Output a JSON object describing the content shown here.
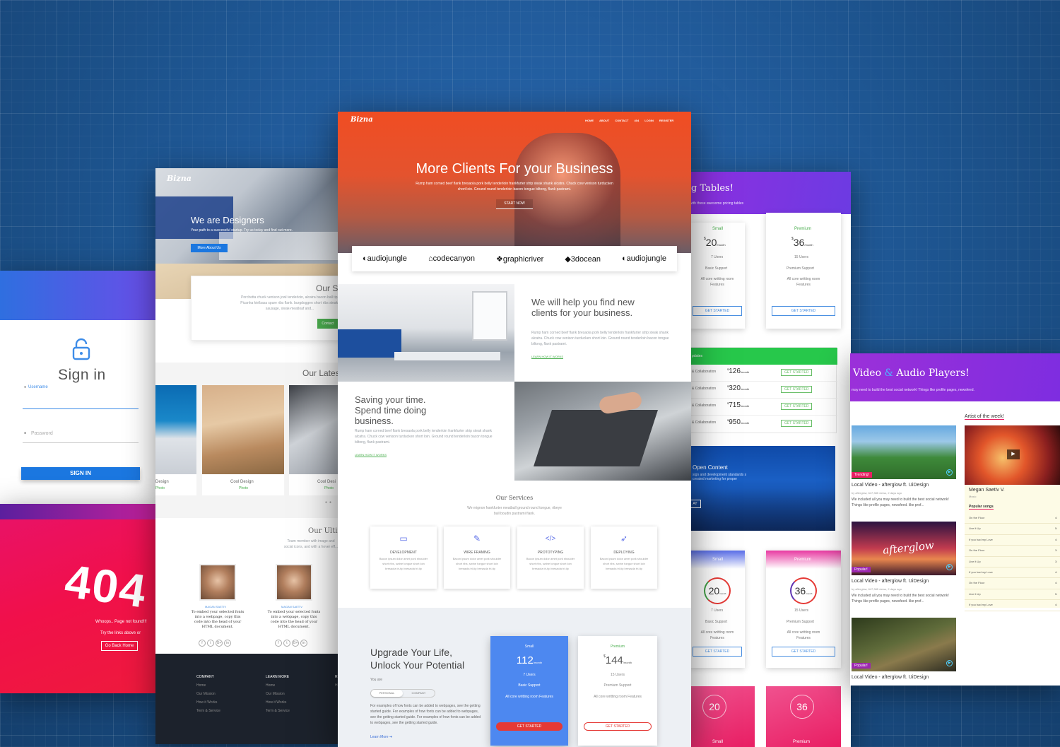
{
  "colors": {
    "bg": "#1f5ea8",
    "orange": "#f04d23",
    "purple": "#9b30d9",
    "red": "#f1104a",
    "blue": "#1b77e0"
  },
  "login": {
    "title": "Sign in",
    "username": "Username",
    "password": "Password",
    "button": "SIGN IN"
  },
  "e404": {
    "code": "404",
    "message": "Whoops.. Page not found!!!",
    "hint": "Try the links above or",
    "button": "Go Back Home"
  },
  "left": {
    "logo": "Bizna",
    "hero_title": "We are Designers",
    "hero_sub": "Your path to a successful startup. Try us today and find out more.",
    "hero_btn": "More About Us",
    "box_title": "Our St",
    "box_text": "Porchetta chuck venison jowl tenderloin, alcatra bacon ball tip. Picanha kielbasa spare ribs flank. burgdoggen short ribs steak-sausage, steak-meatloaf and...",
    "box_btn": "Contact",
    "latest_title": "Our Lates",
    "cards": [
      {
        "title": "Design",
        "cat": "Photo"
      },
      {
        "title": "Cool Design",
        "cat": "Photo"
      },
      {
        "title": "Cool Desi",
        "cat": "Photo"
      }
    ],
    "team_title": "Our Ultima",
    "team_sub": "Team member with image and social icons, and with a hover eff...",
    "members": [
      {
        "name": "MAGAN SAETIV",
        "text": "To embed your selected fonts into a webpage, copy this code into the head of your HTML document."
      },
      {
        "name": "MAGAN SAETIV",
        "text": "To embed your selected fonts into a webpage, copy this code into the head of your HTML document."
      }
    ],
    "social": [
      "f",
      "t",
      "G+",
      "in"
    ],
    "footer": [
      {
        "title": "COMPANY",
        "links": [
          "Home",
          "Our Mission",
          "How it Works",
          "Term & Service"
        ]
      },
      {
        "title": "LEARN MORE",
        "links": [
          "Home",
          "Our Mission",
          "How it Works",
          "Term & Service"
        ]
      },
      {
        "title": "R",
        "links": [
          "H"
        ]
      }
    ]
  },
  "main": {
    "logo": "Bizna",
    "nav": [
      "HOME",
      "ABOUT",
      "CONTACT",
      "404",
      "LOGIN",
      "REGISTER"
    ],
    "hero_title": "More Clients For your Business",
    "hero_text": "Rump ham corned beef flank bresaola pork belly tenderloin frankfurter strip steak shank alcatra. Chuck cow venison turducken short loin. Ground round tenderloin bacon tongue biltong, flank pastrami.",
    "hero_btn": "START NOW",
    "brands": [
      "audiojungle",
      "codecanyon",
      "graphicriver",
      "3docean",
      "audiojungle"
    ],
    "f1_title": "We will help you find new clients for your business.",
    "f1_text": "Rump ham corned beef flank bresaola pork belly tenderloin frankfurter strip steak shank alcatra. Chuck cow venison turducken short loin. Ground round tenderloin bacon tongue biltong, flank pastrami.",
    "f1_link": "LEARN HOW IT WORKS",
    "f2_title": "Saving your time. Spend time doing business.",
    "f2_text": "Rump ham corned beef flank bresaola pork belly tenderloin frankfurter strip steak shank alcatra. Chuck cow venison turducken short loin. Ground round tenderloin bacon tongue biltong, flank pastrami.",
    "f2_link": "LEARN HOW IT WORKS",
    "services_title": "Our Services",
    "services_sub": "We mignon frankfurter meatball ground round tongue, ribeye ball boudin pastrami flank.",
    "services": [
      {
        "icon": "laptop-icon",
        "glyph": "💻",
        "title": "DEVELOPMENT",
        "text": "Bacon ipsum dolor amet pork shoulder short ribs, swine tongue short loin bresaola tri-tip bresaola tri-tip"
      },
      {
        "icon": "pencil-icon",
        "glyph": "✎",
        "title": "WIRE FRAMING",
        "text": "Bacon ipsum dolor amet pork shoulder short ribs, swine tongue short loin bresaola tri-tip bresaola tri-tip"
      },
      {
        "icon": "code-icon",
        "glyph": "</>",
        "title": "PROTOTYPING",
        "text": "Bacon ipsum dolor amet pork shoulder short ribs, swine tongue short loin bresaola tri-tip bresaola tri-tip"
      },
      {
        "icon": "rocket-icon",
        "glyph": "🚀",
        "title": "DEPLOYING",
        "text": "Bacon ipsum dolor amet pork shoulder short ribs, swine tongue short loin bresaola tri-tip bresaola tri-tip"
      }
    ],
    "upgrade_title": "Upgrade Your Life, Unlock Your Potential",
    "you_are": "You are",
    "toggle": [
      "PERSONAL",
      "COMPANY"
    ],
    "upgrade_text": "For examples of how fonts can be added to webpages, see the getting started guide. For examples of how fonts can be added to webpages, see the getting started guide. For examples of how fonts can be added to webpages, see the getting started guide.",
    "learn_more": "Learn More ➔",
    "plans": [
      {
        "name": "Small",
        "price": "112",
        "per": "/month",
        "users": "7 Users",
        "support": "Basic Support",
        "features": "All core writting room Features",
        "btn": "GET STARTED"
      },
      {
        "name": "Premium",
        "price": "144",
        "per": "/month",
        "users": "15 Users",
        "support": "Premium Support",
        "features": "All core writting room Features",
        "btn": "GET STARTED"
      }
    ]
  },
  "right": {
    "title": "g Tables!",
    "sub": "with these awesome pricing tables",
    "plans": [
      {
        "name": "Small",
        "price": "20",
        "per": "/month",
        "users": "7 Users",
        "support": "Basic Support",
        "features": "All core writting room Features",
        "btn": "GET STARTED"
      },
      {
        "name": "Premium",
        "price": "36",
        "per": "/month",
        "users": "15 Users",
        "support": "Premium Support",
        "features": "All core writting room Features",
        "btn": "GET STARTED"
      }
    ],
    "list_header": "pdates",
    "rows": [
      {
        "label": "& Collaboration",
        "price": "126",
        "per": "/month",
        "btn": "GET STARTED"
      },
      {
        "label": "& Collaboration",
        "price": "320",
        "per": "/month",
        "btn": "GET STARTED"
      },
      {
        "label": "& Collaboration",
        "price": "715",
        "per": "/month",
        "btn": "GET STARTED"
      },
      {
        "label": "& Collaboration",
        "price": "950",
        "per": "/month",
        "btn": "GET STARTED"
      }
    ],
    "open_title": "Open Content",
    "open_text": "sign and development standards s created marketing for proper",
    "open_btn": "AY",
    "plans2": [
      {
        "name": "Small",
        "price": "20",
        "per": "/month",
        "users": "7 Users",
        "support": "Basic Support",
        "features": "All core writting room Features",
        "btn": "GET STARTED"
      },
      {
        "name": "Premium",
        "price": "36",
        "per": "/month",
        "users": "15 Users",
        "support": "Premium Support",
        "features": "All core writting room Features",
        "btn": "GET STARTED"
      }
    ],
    "plans3": [
      {
        "name": "Small",
        "price": "20"
      },
      {
        "name": "Premium",
        "price": "36"
      }
    ]
  },
  "video": {
    "title": "Video & Audio Players!",
    "title_a": "Video",
    "title_amp": "&",
    "title_b": "Audio Players!",
    "sub": "may need to build the best social network! Things like profile pages, newsfeed.",
    "items": [
      {
        "badge": "Trending!",
        "title": "Local Video - afterglow ft. UiDesign",
        "meta": "by afterglow, 647,385 views, 2 days ago",
        "text": "We included all you may need to build the best social network! Things like profile pages, newsfeed. like prof..."
      },
      {
        "badge": "Popular!",
        "title": "Local Video - afterglow ft. UiDesign",
        "meta": "by afterglow, 647,385 views, 2 days ago",
        "text": "We included all you may need to build the best social network! Things like profile pages, newsfeed. like prof..."
      },
      {
        "badge": "Popular!",
        "title": "Local Video - afterglow ft. UiDesign"
      }
    ],
    "thumb_text": "afterglow",
    "artist_label": "Artist of the week!",
    "artist_name": "Megan Saetiv V.",
    "artist_genre": "Music",
    "popular_label": "Popular songs",
    "songs": [
      {
        "t": "On the Floor",
        "d": "4:"
      },
      {
        "t": "Live it Up",
        "d": "5:"
      },
      {
        "t": "If you had my Love",
        "d": "4:"
      },
      {
        "t": "On the Floor",
        "d": "3:"
      },
      {
        "t": "Live it Up",
        "d": "3:"
      },
      {
        "t": "If you had my Love",
        "d": "4:"
      },
      {
        "t": "On the Floor",
        "d": "4:"
      },
      {
        "t": "Live it Up",
        "d": "5:"
      },
      {
        "t": "If you had my Love",
        "d": "4:"
      }
    ]
  }
}
